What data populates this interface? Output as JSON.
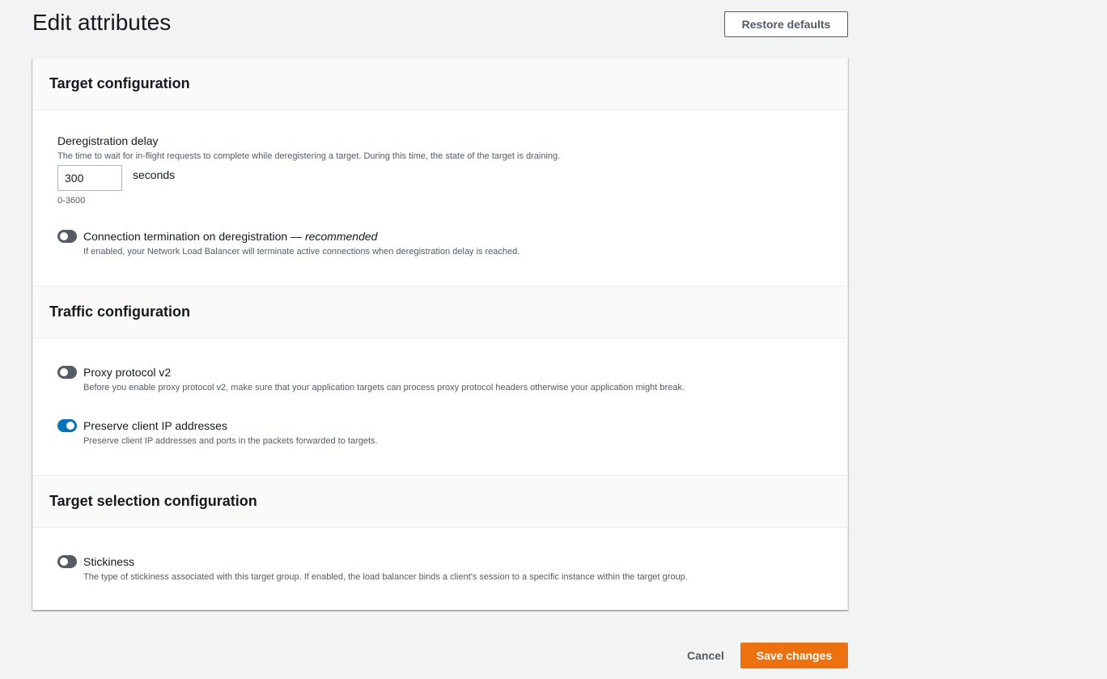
{
  "header": {
    "title": "Edit attributes",
    "restore_defaults_label": "Restore defaults"
  },
  "sections": {
    "target_configuration": {
      "title": "Target configuration",
      "deregistration_delay": {
        "label": "Deregistration delay",
        "description": "The time to wait for in-flight requests to complete while deregistering a target. During this time, the state of the target is draining.",
        "value": "300",
        "unit": "seconds",
        "constraint": "0-3600"
      },
      "connection_termination": {
        "label": "Connection termination on deregistration — ",
        "label_emphasis": "recommended",
        "description": "If enabled, your Network Load Balancer will terminate active connections when deregistration delay is reached.",
        "enabled": false
      }
    },
    "traffic_configuration": {
      "title": "Traffic configuration",
      "proxy_protocol": {
        "label": "Proxy protocol v2",
        "description": "Before you enable proxy protocol v2, make sure that your application targets can process proxy protocol headers otherwise your application might break.",
        "enabled": false
      },
      "preserve_client_ip": {
        "label": "Preserve client IP addresses",
        "description": "Preserve client IP addresses and ports in the packets forwarded to targets.",
        "enabled": true
      }
    },
    "target_selection_configuration": {
      "title": "Target selection configuration",
      "stickiness": {
        "label": "Stickiness",
        "description": "The type of stickiness associated with this target group. If enabled, the load balancer binds a client's session to a specific instance within the target group.",
        "enabled": false
      }
    }
  },
  "footer": {
    "cancel_label": "Cancel",
    "save_label": "Save changes"
  },
  "colors": {
    "primary_button": "#ec7211",
    "toggle_on": "#0073bb",
    "toggle_off": "#545b64"
  }
}
